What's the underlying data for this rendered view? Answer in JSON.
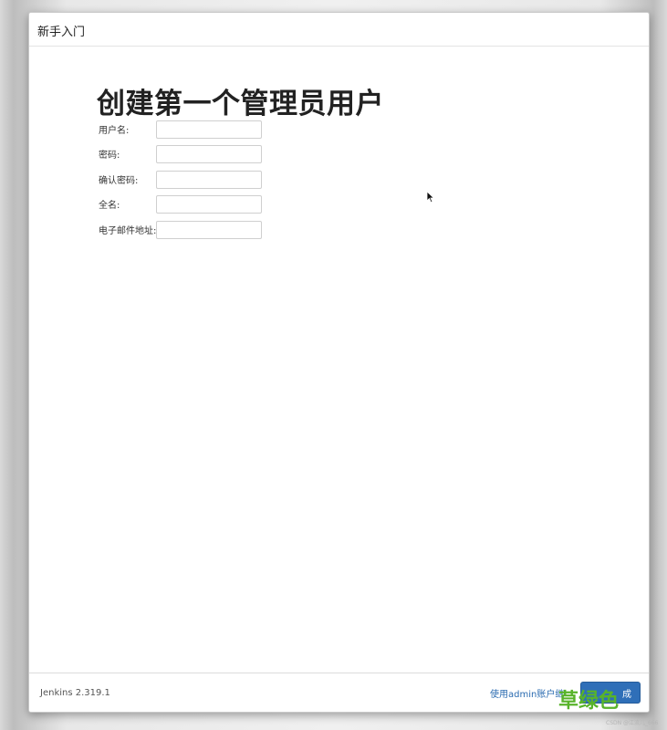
{
  "dialog": {
    "title": "新手入门"
  },
  "page": {
    "heading": "创建第一个管理员用户"
  },
  "form": {
    "fields": [
      {
        "label": "用户名:",
        "value": ""
      },
      {
        "label": "密码:",
        "value": ""
      },
      {
        "label": "确认密码:",
        "value": ""
      },
      {
        "label": "全名:",
        "value": ""
      },
      {
        "label": "电子邮件地址:",
        "value": ""
      }
    ]
  },
  "footer": {
    "version": "Jenkins 2.319.1",
    "admin_link": "使用admin账户继",
    "save_button": "成"
  },
  "watermark": {
    "text": "草绿色",
    "small": "CSDN @江流儿_666"
  },
  "colors": {
    "primary_button": "#2f6fb8",
    "link": "#2a6bb0",
    "watermark": "#58b32a"
  }
}
